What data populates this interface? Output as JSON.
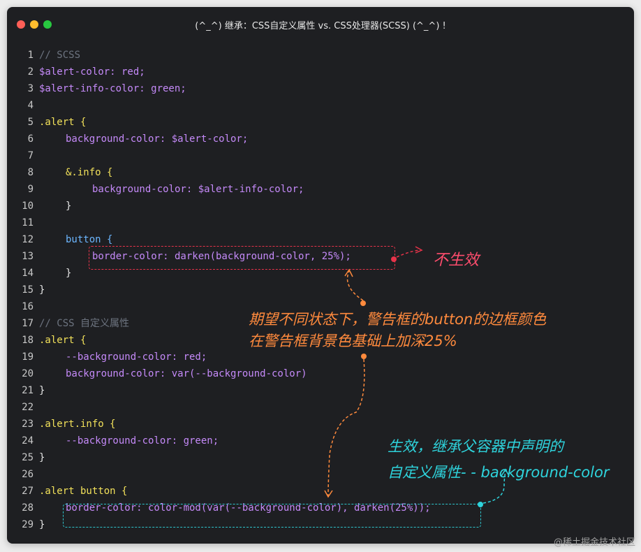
{
  "window": {
    "title": "(^_^) 继承：CSS自定义属性 vs. CSS处理器(SCSS) (^_^) !"
  },
  "code": {
    "lines": [
      {
        "n": "1",
        "t": "// SCSS"
      },
      {
        "n": "2",
        "t": "$alert-color: red;"
      },
      {
        "n": "3",
        "t": "$alert-info-color: green;"
      },
      {
        "n": "4",
        "t": ""
      },
      {
        "n": "5",
        "t": ".alert {"
      },
      {
        "n": "6",
        "t": "background-color: $alert-color;"
      },
      {
        "n": "7",
        "t": ""
      },
      {
        "n": "8",
        "t": "&.info {"
      },
      {
        "n": "9",
        "t": "background-color: $alert-info-color;"
      },
      {
        "n": "10",
        "t": "}"
      },
      {
        "n": "11",
        "t": ""
      },
      {
        "n": "12",
        "t": "button {"
      },
      {
        "n": "13",
        "t": "border-color: darken(background-color, 25%);"
      },
      {
        "n": "14",
        "t": "}"
      },
      {
        "n": "15",
        "t": "}"
      },
      {
        "n": "16",
        "t": ""
      },
      {
        "n": "17",
        "t": "// CSS 自定义属性"
      },
      {
        "n": "18",
        "t": ".alert {"
      },
      {
        "n": "19",
        "t": "--background-color: red;"
      },
      {
        "n": "20",
        "t": "background-color: var(--background-color)"
      },
      {
        "n": "21",
        "t": "}"
      },
      {
        "n": "22",
        "t": ""
      },
      {
        "n": "23",
        "t": ".alert.info {"
      },
      {
        "n": "24",
        "t": "--background-color: green;"
      },
      {
        "n": "25",
        "t": "}"
      },
      {
        "n": "26",
        "t": ""
      },
      {
        "n": "27",
        "t": ".alert button {"
      },
      {
        "n": "28",
        "t": "border-color: color-mod(var(--background-color), darken(25%));"
      },
      {
        "n": "29",
        "t": "}"
      }
    ]
  },
  "annotations": {
    "not_effective": "不生效",
    "expectation_line1": "期望不同状态下，警告框的button的边框颜色",
    "expectation_line2": "在警告框背景色基础上加深25%",
    "effective_line1": "生效，继承父容器中声明的",
    "effective_line2": "自定义属性- - background-color"
  },
  "watermark": "@稀土掘金技术社区",
  "colors": {
    "background": "#1e1f22",
    "annotation_red": "#ff4d6d",
    "annotation_orange": "#ff8a3d",
    "annotation_cyan": "#2ed3dc"
  }
}
